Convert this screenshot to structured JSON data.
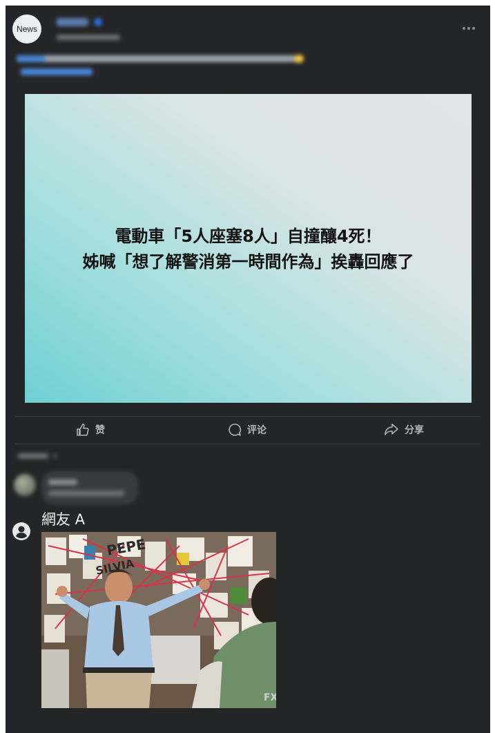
{
  "post": {
    "avatar_text": "News",
    "headline_line1": "電動車「5人座塞8人」自撞釀4死！",
    "headline_line2": "姊喊「想了解警消第一時間作為」挨轟回應了"
  },
  "actions": {
    "like": "赞",
    "comment": "评论",
    "share": "分享"
  },
  "comment": {
    "user": "網友 A"
  },
  "meme": {
    "board_text_1": "PEPE",
    "board_text_2": "SILVIA",
    "watermark": "FX"
  },
  "colors": {
    "background": "#242526",
    "action_text": "#b0b3b8",
    "divider": "#3e4042"
  }
}
